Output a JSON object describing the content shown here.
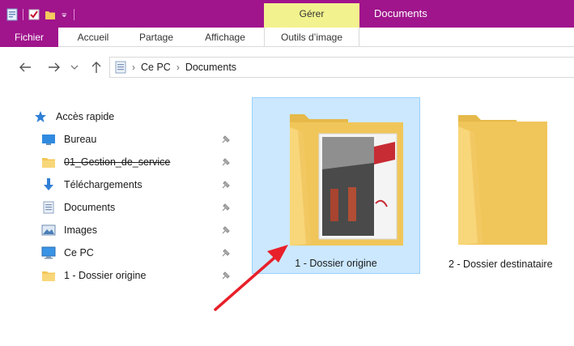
{
  "window": {
    "title": "Documents",
    "context_tab": "Gérer"
  },
  "ribbon": {
    "tabs": [
      {
        "label": "Fichier"
      },
      {
        "label": "Accueil"
      },
      {
        "label": "Partage"
      },
      {
        "label": "Affichage"
      },
      {
        "label": "Outils d’image"
      }
    ]
  },
  "address": {
    "path": [
      "Ce PC",
      "Documents"
    ]
  },
  "navpane": {
    "quick_access": "Accès rapide",
    "items": [
      {
        "label": "Bureau",
        "icon": "desktop-icon",
        "pinned": true
      },
      {
        "label": "01_Gestion_de_service",
        "icon": "folder-icon",
        "pinned": true
      },
      {
        "label": "Téléchargements",
        "icon": "download-icon",
        "pinned": true
      },
      {
        "label": "Documents",
        "icon": "documents-icon",
        "pinned": true
      },
      {
        "label": "Images",
        "icon": "images-icon",
        "pinned": true
      },
      {
        "label": "Ce PC",
        "icon": "computer-icon",
        "pinned": true
      },
      {
        "label": "1 - Dossier origine",
        "icon": "folder-icon",
        "pinned": true
      }
    ]
  },
  "content": {
    "items": [
      {
        "label": "1 - Dossier origine",
        "selected": true,
        "has_preview": true
      },
      {
        "label": "2 - Dossier destinataire",
        "selected": false,
        "has_preview": false
      }
    ]
  },
  "colors": {
    "titlebar": "#a0148c",
    "context_tab": "#f2f28e",
    "selection": "#cce8ff",
    "annotation_arrow": "#e8202a"
  }
}
